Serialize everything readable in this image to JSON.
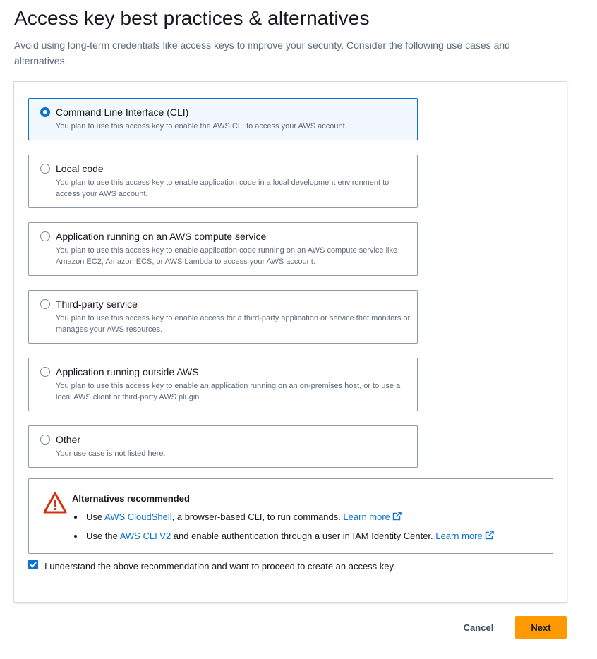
{
  "header": {
    "title": "Access key best practices & alternatives",
    "description": "Avoid using long-term credentials like access keys to improve your security. Consider the following use cases and alternatives."
  },
  "use_cases": [
    {
      "label": "Command Line Interface (CLI)",
      "description": "You plan to use this access key to enable the AWS CLI to access your AWS account.",
      "selected": true
    },
    {
      "label": "Local code",
      "description": "You plan to use this access key to enable application code in a local development environment to access your AWS account.",
      "selected": false
    },
    {
      "label": "Application running on an AWS compute service",
      "description": "You plan to use this access key to enable application code running on an AWS compute service like Amazon EC2, Amazon ECS, or AWS Lambda to access your AWS account.",
      "selected": false
    },
    {
      "label": "Third-party service",
      "description": "You plan to use this access key to enable access for a third-party application or service that monitors or manages your AWS resources.",
      "selected": false
    },
    {
      "label": "Application running outside AWS",
      "description": "You plan to use this access key to enable an application running on an on-premises host, or to use a local AWS client or third-party AWS plugin.",
      "selected": false
    },
    {
      "label": "Other",
      "description": "Your use case is not listed here.",
      "selected": false
    }
  ],
  "alert": {
    "title": "Alternatives recommended",
    "icon": "warning-icon",
    "items": [
      {
        "prefix": "Use ",
        "link": "AWS CloudShell",
        "middle": ", a browser-based CLI, to run commands. ",
        "learn_more": "Learn more"
      },
      {
        "prefix": "Use the ",
        "link": "AWS CLI V2",
        "middle": " and enable authentication through a user in IAM Identity Center. ",
        "learn_more": "Learn more"
      }
    ]
  },
  "acknowledgement": {
    "text": "I understand the above recommendation and want to proceed to create an access key.",
    "checked": true
  },
  "footer": {
    "cancel_label": "Cancel",
    "next_label": "Next"
  },
  "colors": {
    "accent": "#0972d3",
    "primary_button": "#ff9900",
    "warning": "#d13212",
    "text": "#16191f",
    "secondary_text": "#5f6b7a"
  }
}
